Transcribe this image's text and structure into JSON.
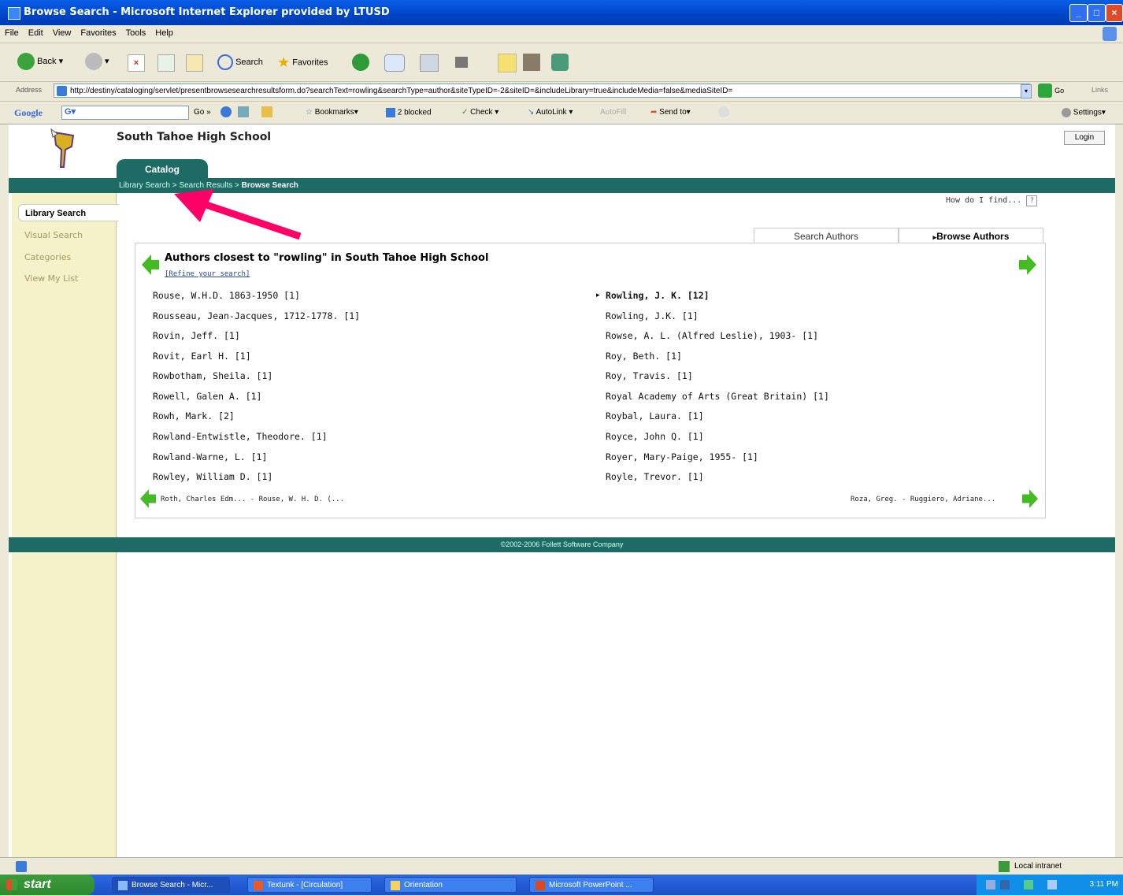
{
  "window": {
    "title": "Browse Search - Microsoft Internet Explorer provided by LTUSD"
  },
  "menu": [
    "File",
    "Edit",
    "View",
    "Favorites",
    "Tools",
    "Help"
  ],
  "toolbar": {
    "back": "Back",
    "search": "Search",
    "favorites": "Favorites"
  },
  "address": {
    "label": "Address",
    "url": "http://destiny/cataloging/servlet/presentbrowsesearchresultsform.do?searchText=rowling&searchType=author&siteTypeID=-2&siteID=&includeLibrary=true&includeMedia=false&mediaSiteID=",
    "go": "Go",
    "links": "Links"
  },
  "googlebar": {
    "label": "Google",
    "go": "Go",
    "bookmarks": "Bookmarks",
    "blocked": "2 blocked",
    "check": "Check",
    "autolink": "AutoLink",
    "autofill": "AutoFill",
    "sendto": "Send to",
    "settings": "Settings"
  },
  "page": {
    "school": "South Tahoe High School",
    "login": "Login",
    "catalog_tab": "Catalog",
    "breadcrumb": {
      "link1": "Library Search",
      "sep1": " > ",
      "link2": "Search Results",
      "sep2": " > ",
      "current": "Browse Search"
    },
    "sidebar": [
      "Library Search",
      "Visual Search",
      "Categories",
      "View My List"
    ],
    "howdo": "How do I find...",
    "tabs": {
      "search": "Search Authors",
      "browse": "Browse Authors"
    },
    "panel_title": "Authors closest to \"rowling\" in South Tahoe High School",
    "refine": "[Refine your search]",
    "left_col": [
      "Rouse, W.H.D. 1863-1950 [1]",
      "Rousseau, Jean-Jacques, 1712-1778. [1]",
      "Rovin, Jeff. [1]",
      "Rovit, Earl H. [1]",
      "Rowbotham, Sheila. [1]",
      "Rowell, Galen A. [1]",
      "Rowh, Mark. [2]",
      "Rowland-Entwistle, Theodore. [1]",
      "Rowland-Warne, L. [1]",
      "Rowley, William D. [1]"
    ],
    "right_col": [
      "Rowling, J. K. [12]",
      "Rowling, J.K. [1]",
      "Rowse, A. L. (Alfred Leslie), 1903- [1]",
      "Roy, Beth. [1]",
      "Roy, Travis. [1]",
      "Royal Academy of Arts (Great Britain) [1]",
      "Roybal, Laura. [1]",
      "Royce, John Q. [1]",
      "Royer, Mary-Paige, 1955- [1]",
      "Royle, Trevor. [1]"
    ],
    "prev_range": "Roth, Charles Edm... - Rouse, W. H. D. (...",
    "next_range": "Roza, Greg. - Ruggiero, Adriane...",
    "footer": "©2002-2006 Follett Software Company"
  },
  "status": {
    "zone": "Local intranet"
  },
  "taskbar": {
    "start": "start",
    "tasks": [
      "Browse Search - Micr...",
      "Textunk - [Circulation]",
      "Orientation",
      "Microsoft PowerPoint ..."
    ],
    "clock": "3:11 PM"
  },
  "colors": {
    "accent": "#1d6b64",
    "arrow": "#ff0066",
    "nav_arrow": "#44bb22"
  }
}
